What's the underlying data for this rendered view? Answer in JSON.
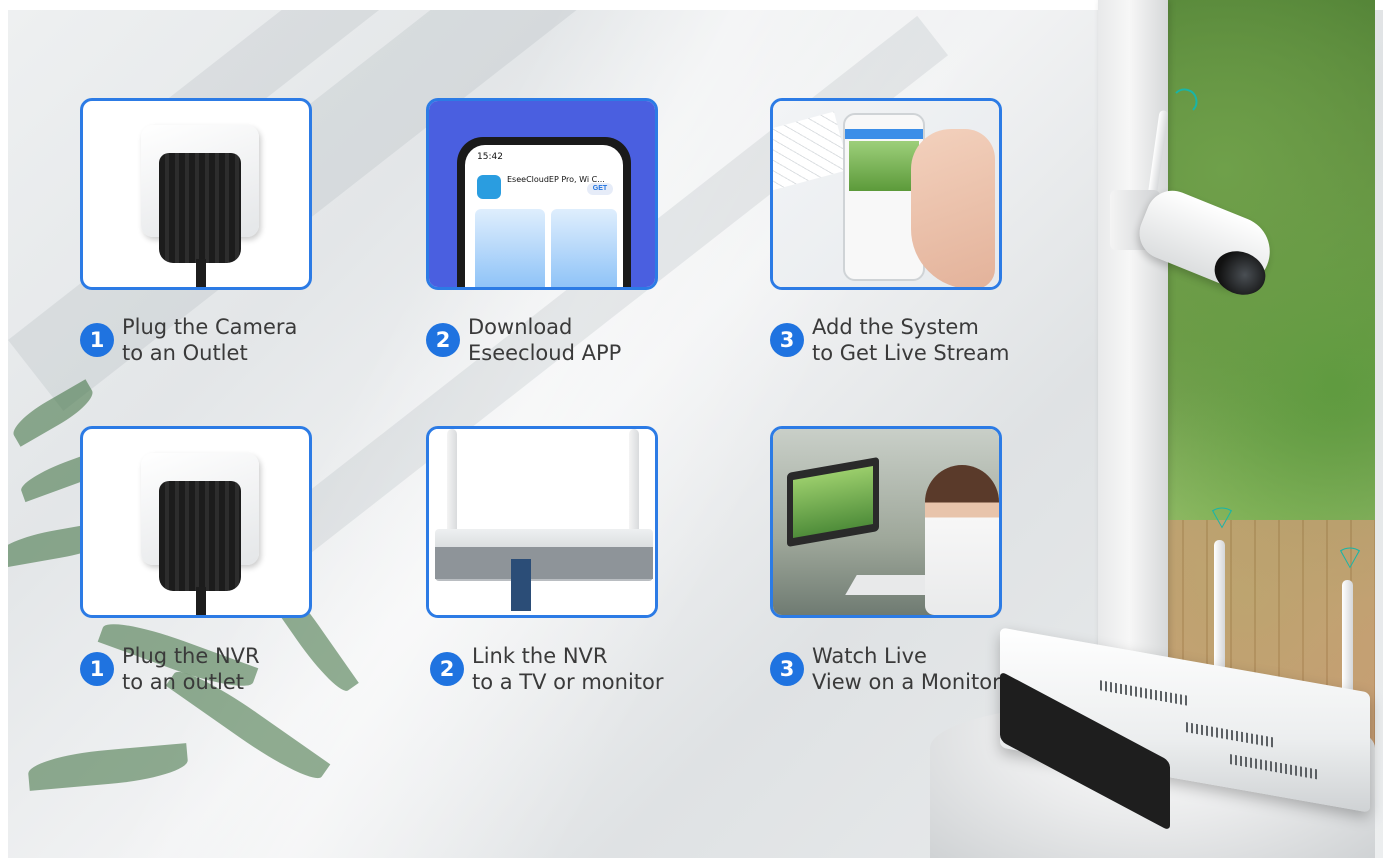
{
  "steps": [
    {
      "number": "1",
      "line1": "Plug the Camera",
      "line2": "to an Outlet"
    },
    {
      "number": "2",
      "line1": "Download",
      "line2": "Eseecloud APP"
    },
    {
      "number": "3",
      "line1": "Add the System",
      "line2": "to Get Live Stream"
    },
    {
      "number": "1",
      "line1": "Plug the NVR",
      "line2": "to an outlet"
    },
    {
      "number": "2",
      "line1": "Link the NVR",
      "line2": "to a TV or monitor"
    },
    {
      "number": "3",
      "line1": "Watch Live",
      "line2": "View on a Monitor"
    }
  ],
  "app_screen": {
    "time": "15:42",
    "app_name": "EseeCloudEP Pro, Wi C...",
    "get_label": "GET"
  },
  "icons": {
    "wifi": "wifi-signal-icon"
  },
  "colors": {
    "accent": "#1f73e0",
    "card_border": "#2c7be5",
    "wifi": "#18b5a8"
  }
}
